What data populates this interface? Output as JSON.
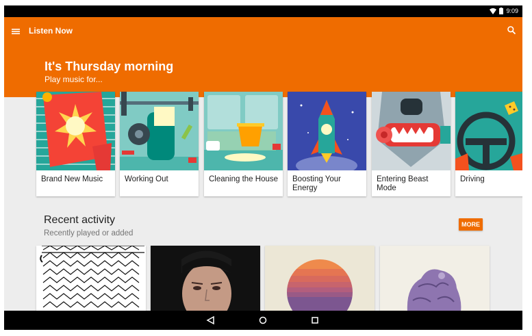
{
  "status_bar": {
    "time": "9:09",
    "icons": [
      "wifi-icon",
      "battery-icon"
    ]
  },
  "header": {
    "title": "Listen Now",
    "menu_icon": "menu-icon",
    "search_icon": "search-icon",
    "color": "#ef6c00"
  },
  "greeting": {
    "title": "It's Thursday morning",
    "subtitle": "Play music for..."
  },
  "cards": [
    {
      "label": "Brand New Music"
    },
    {
      "label": "Working Out"
    },
    {
      "label": "Cleaning the House"
    },
    {
      "label": "Boosting Your Energy"
    },
    {
      "label": "Entering Beast Mode"
    },
    {
      "label": "Driving"
    }
  ],
  "recent": {
    "title": "Recent activity",
    "subtitle": "Recently played or added",
    "more_label": "MORE"
  },
  "nav": {
    "icons": [
      "back-icon",
      "home-icon",
      "recents-icon"
    ]
  }
}
